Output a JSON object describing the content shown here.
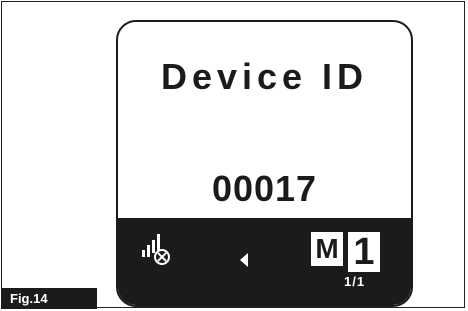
{
  "figure": {
    "label": "Fig.14"
  },
  "screen": {
    "title": "Device ID",
    "value": "00017"
  },
  "status_bar": {
    "signal_icon": "signal-no-connection-icon",
    "nav_icon": "back-arrow-icon",
    "mode_letter": "M",
    "mode_number": "1",
    "page_indicator": "1/1"
  },
  "colors": {
    "foreground": "#1b1b1b",
    "background": "#ffffff"
  }
}
